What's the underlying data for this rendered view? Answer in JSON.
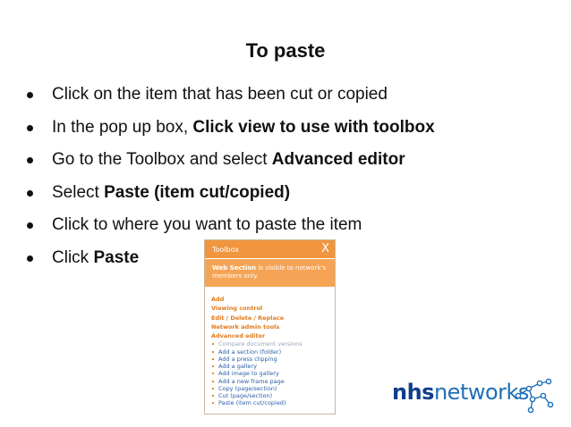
{
  "slide": {
    "title": "To paste",
    "bullets": [
      {
        "text": "Click on the item that has been cut or copied",
        "bold": ""
      },
      {
        "text": "In the pop up box, ",
        "bold": "Click view to use with toolbox"
      },
      {
        "text": "Go to the Toolbox and select ",
        "bold": "Advanced editor"
      },
      {
        "text": "Select ",
        "bold": "Paste (item cut/copied)"
      },
      {
        "text": "Click to where you want to paste the item",
        "bold": ""
      },
      {
        "text": "Click ",
        "bold": "Paste"
      }
    ]
  },
  "toolbox": {
    "title": "Toolbox",
    "close": "X",
    "notice_bold": "Web Section",
    "notice_rest": " is visible to network's members only.",
    "links": [
      "Add",
      "Viewing control",
      "Edit / Delete / Replace",
      "Network admin tools",
      "Advanced editor"
    ],
    "items": [
      {
        "label": "Compare document versions",
        "disabled": true
      },
      {
        "label": "Add a section (folder)",
        "disabled": false
      },
      {
        "label": "Add a press clipping",
        "disabled": false
      },
      {
        "label": "Add a gallery",
        "disabled": false
      },
      {
        "label": "Add image to gallery",
        "disabled": false
      },
      {
        "label": "Add a new frame page",
        "disabled": false
      },
      {
        "label": "Copy (page/section)",
        "disabled": false
      },
      {
        "label": "Cut (page/section)",
        "disabled": false
      },
      {
        "label": "Paste (item cut/copied)",
        "disabled": false
      }
    ]
  },
  "logo": {
    "part1": "nhs",
    "part2": "networks"
  },
  "colors": {
    "accent": "#f1963f",
    "link": "#2b5ea8",
    "brand_dark": "#0f3e8c",
    "brand": "#1f6fb8"
  }
}
